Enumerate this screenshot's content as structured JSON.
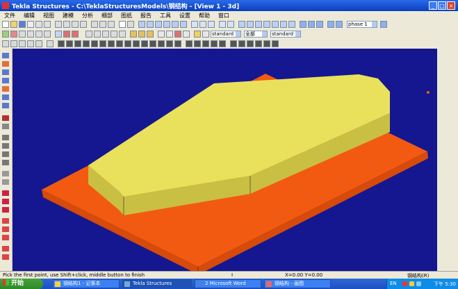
{
  "window": {
    "title": "Tekla Structures - C:\\TeklaStructuresModels\\钢结构 - [View 1 - 3d]",
    "minimize": "_",
    "maximize": "□",
    "close": "×"
  },
  "menu": [
    "文件",
    "编辑",
    "视图",
    "建模",
    "分析",
    "细部",
    "图纸",
    "报告",
    "工具",
    "设置",
    "帮助",
    "窗口"
  ],
  "toolbar": {
    "combo_phase": "phase 1",
    "combo_class": "standard",
    "combo_type": "全部",
    "combo_filter": "standard"
  },
  "model_colors": {
    "background": "#141790",
    "plate_top": "#e9e05c",
    "plate_side": "#c9bf43",
    "base_top": "#f25a12",
    "base_side": "#d64a0a"
  },
  "status": {
    "left": "Pick the first point, use Shift+click, middle button to finish",
    "mid": "I",
    "coords": "X=0.00  Y=0.00",
    "mode": "钢结构(R)"
  },
  "taskbar": {
    "start": "开始",
    "tasks": [
      "钢结构1 - 记事本",
      "Tekla Structures",
      "2 Microsoft Word",
      "钢结构 - 画图"
    ],
    "tray_text": "EN",
    "clock": "下午 5:30"
  }
}
